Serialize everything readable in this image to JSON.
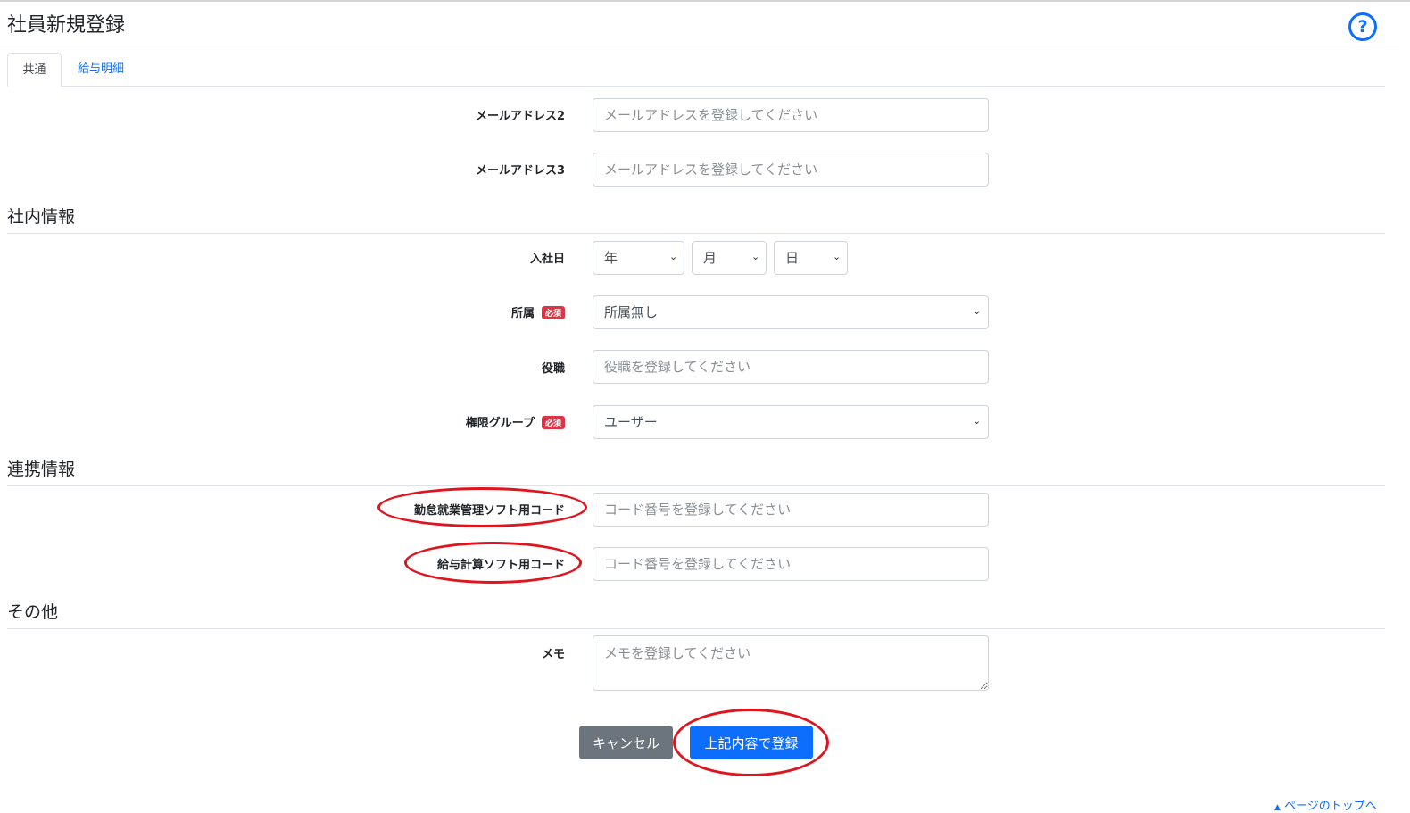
{
  "page": {
    "title": "社員新規登録"
  },
  "help": {
    "symbol": "?"
  },
  "tabs": [
    {
      "label": "共通",
      "active": true
    },
    {
      "label": "給与明細",
      "active": false
    }
  ],
  "fields": {
    "email2": {
      "label": "メールアドレス2",
      "placeholder": "メールアドレスを登録してください"
    },
    "email3": {
      "label": "メールアドレス3",
      "placeholder": "メールアドレスを登録してください"
    },
    "join_date": {
      "label": "入社日",
      "year": "年",
      "month": "月",
      "day": "日"
    },
    "department": {
      "label": "所属",
      "value": "所属無し",
      "required": "必須"
    },
    "position": {
      "label": "役職",
      "placeholder": "役職を登録してください"
    },
    "permission_group": {
      "label": "権限グループ",
      "value": "ユーザー",
      "required": "必須"
    },
    "attendance_code": {
      "label": "勤怠就業管理ソフト用コード",
      "placeholder": "コード番号を登録してください"
    },
    "payroll_code": {
      "label": "給与計算ソフト用コード",
      "placeholder": "コード番号を登録してください"
    },
    "memo": {
      "label": "メモ",
      "placeholder": "メモを登録してください"
    }
  },
  "sections": {
    "internal": "社内情報",
    "integration": "連携情報",
    "other": "その他"
  },
  "buttons": {
    "cancel": "キャンセル",
    "submit": "上記内容で登録"
  },
  "footer": {
    "page_top": "ページのトップへ"
  },
  "colors": {
    "primary": "#0d6efd",
    "secondary": "#6c757d",
    "required_badge": "#dc3545",
    "annotation_ring": "#e0141e"
  },
  "icons": {
    "select": "chevron-down-icon",
    "page_top": "caret-up-icon",
    "help": "question-circle-icon"
  }
}
